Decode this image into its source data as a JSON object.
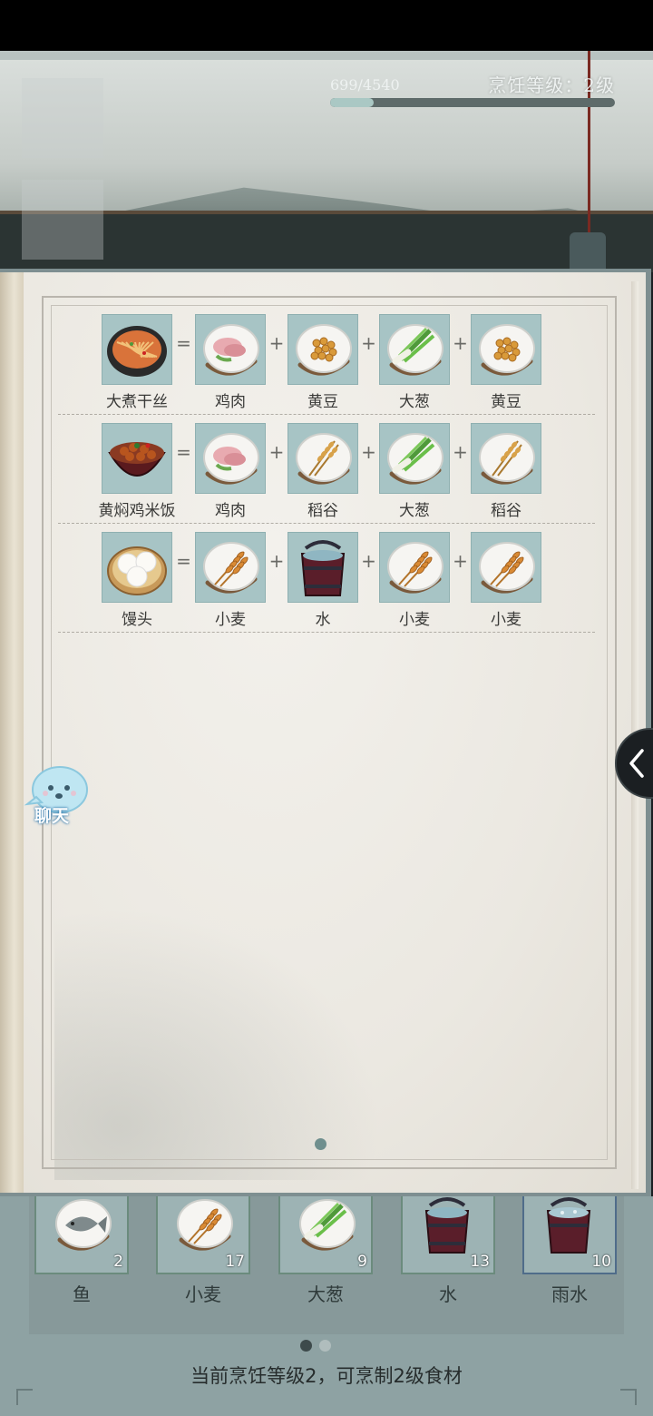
{
  "header": {
    "cook_level_label": "烹饪等级：2级",
    "exp_text": "699/4540",
    "exp_progress": 0.154
  },
  "recipes": [
    {
      "dish": {
        "name": "大煮干丝",
        "icon": "shredded-tofu-dish-icon"
      },
      "ingredients": [
        {
          "name": "鸡肉",
          "icon": "chicken-meat-icon"
        },
        {
          "name": "黄豆",
          "icon": "soybean-icon"
        },
        {
          "name": "大葱",
          "icon": "scallion-icon"
        },
        {
          "name": "黄豆",
          "icon": "soybean-icon"
        }
      ]
    },
    {
      "dish": {
        "name": "黄焖鸡米饭",
        "icon": "braised-chicken-rice-icon"
      },
      "ingredients": [
        {
          "name": "鸡肉",
          "icon": "chicken-meat-icon"
        },
        {
          "name": "稻谷",
          "icon": "rice-grain-icon"
        },
        {
          "name": "大葱",
          "icon": "scallion-icon"
        },
        {
          "name": "稻谷",
          "icon": "rice-grain-icon"
        }
      ]
    },
    {
      "dish": {
        "name": "馒头",
        "icon": "steamed-bun-icon"
      },
      "ingredients": [
        {
          "name": "小麦",
          "icon": "wheat-icon"
        },
        {
          "name": "水",
          "icon": "water-bucket-icon"
        },
        {
          "name": "小麦",
          "icon": "wheat-icon"
        },
        {
          "name": "小麦",
          "icon": "wheat-icon"
        }
      ]
    }
  ],
  "operators": {
    "equals": "=",
    "plus": "+"
  },
  "chat": {
    "label": "聊天"
  },
  "inventory": {
    "items": [
      {
        "name": "鱼",
        "count": "2",
        "icon": "fish-icon"
      },
      {
        "name": "小麦",
        "count": "17",
        "icon": "wheat-icon"
      },
      {
        "name": "大葱",
        "count": "9",
        "icon": "scallion-icon"
      },
      {
        "name": "水",
        "count": "13",
        "icon": "water-bucket-icon"
      },
      {
        "name": "雨水",
        "count": "10",
        "icon": "rain-water-bucket-icon"
      }
    ],
    "note": "当前烹饪等级2，可烹制2级食材"
  },
  "colors": {
    "tile": "#a7c4c5",
    "page": "#ebe8e1",
    "accent": "#6f8f8e"
  }
}
